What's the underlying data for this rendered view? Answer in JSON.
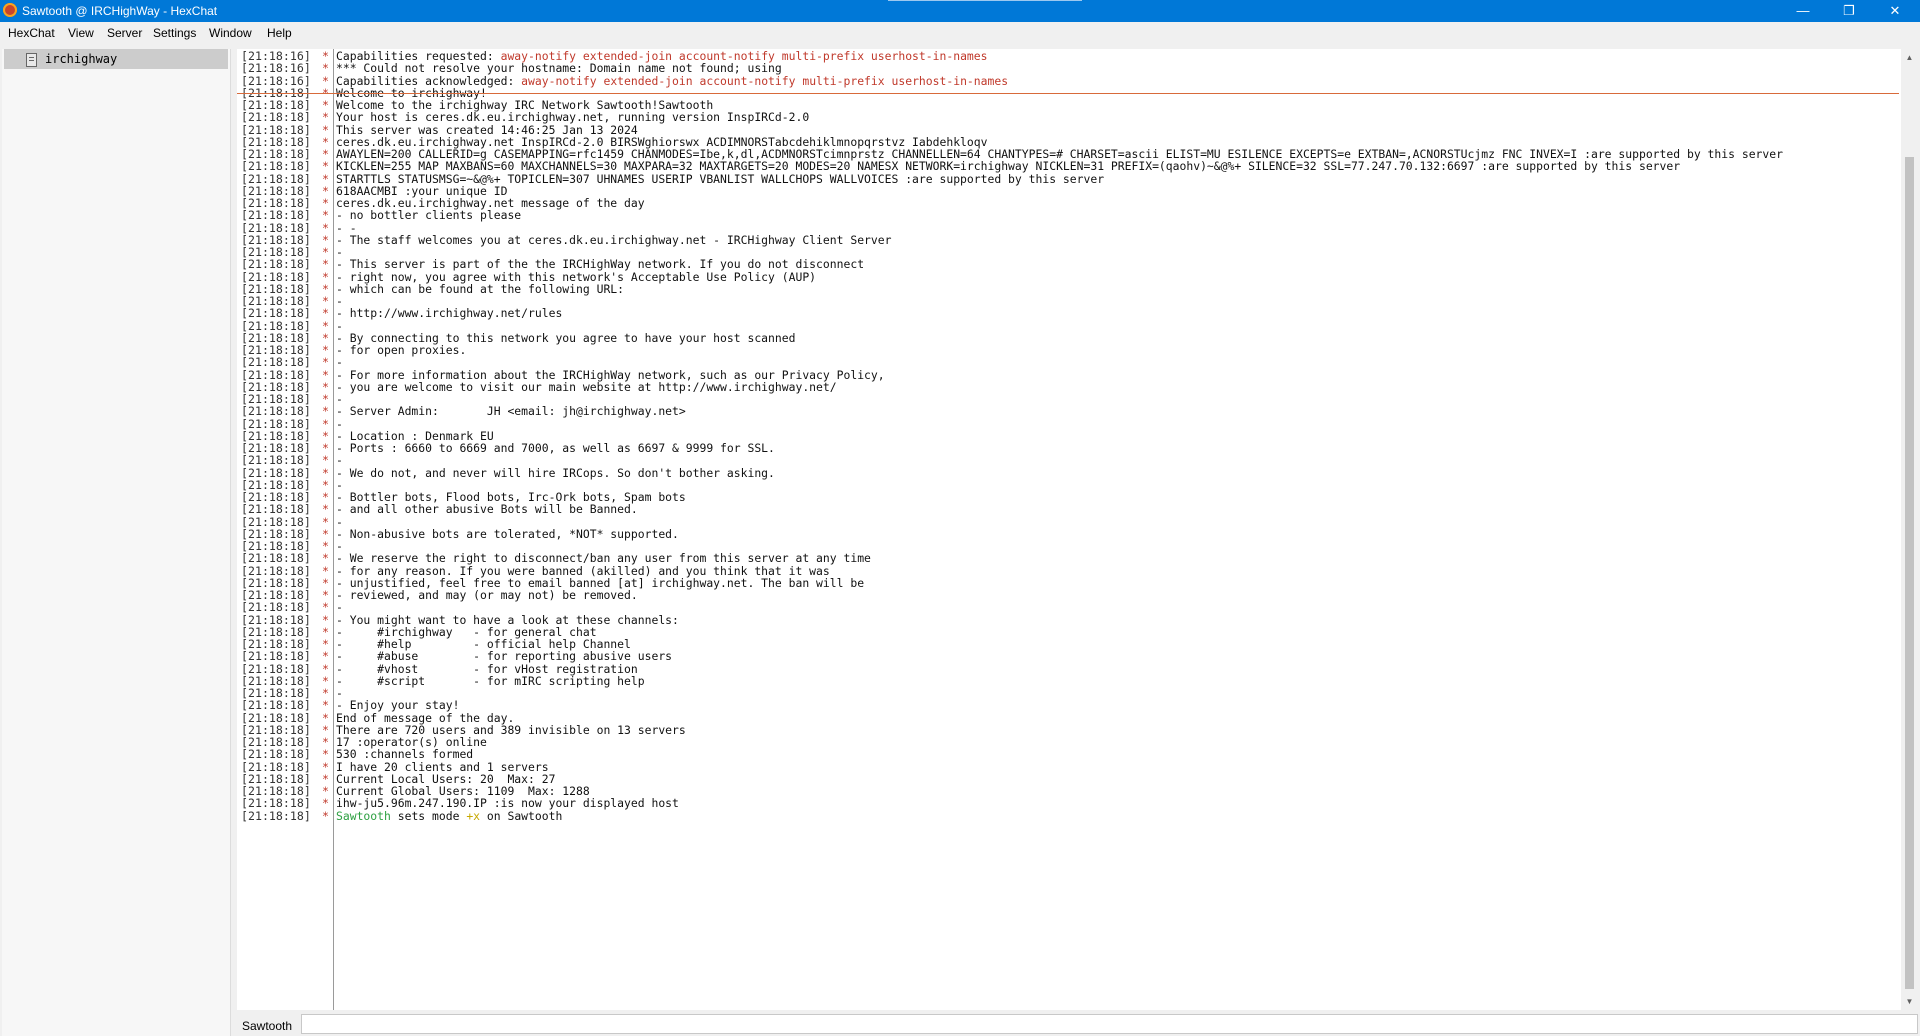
{
  "window": {
    "title": "Sawtooth @ IRCHighWay - HexChat"
  },
  "menu": [
    "HexChat",
    "View",
    "Server",
    "Settings",
    "Window",
    "Help"
  ],
  "sidebar": {
    "items": [
      {
        "label": "irchighway",
        "icon": "server-icon"
      }
    ]
  },
  "colors": {
    "titlebar": "#0078d7",
    "motd": "#b03a3a",
    "nick": "#2ea042",
    "mode": "#c7a800",
    "marker": "#d86a3a"
  },
  "chat": {
    "lines": [
      {
        "ts": "[21:18:16]",
        "p": "*",
        "segs": [
          {
            "t": "Capabilities requested: "
          },
          {
            "t": "away-notify extended-join account-notify multi-prefix userhost-in-names",
            "c": "hl-red"
          }
        ]
      },
      {
        "ts": "[21:18:16]",
        "p": "*",
        "segs": [
          {
            "t": "*** Could not resolve your hostname: Domain name not found; using"
          }
        ]
      },
      {
        "ts": "[21:18:16]",
        "p": "*",
        "segs": [
          {
            "t": "Capabilities acknowledged: "
          },
          {
            "t": "away-notify extended-join account-notify multi-prefix userhost-in-names",
            "c": "hl-red"
          }
        ]
      },
      {
        "ts": "[21:18:18]",
        "p": "*",
        "segs": [
          {
            "t": "Welcome to irchighway!"
          }
        ]
      },
      {
        "ts": "[21:18:18]",
        "p": "*",
        "segs": [
          {
            "t": "Welcome to the irchighway IRC Network Sawtooth!Sawtooth"
          }
        ]
      },
      {
        "ts": "[21:18:18]",
        "p": "*",
        "segs": [
          {
            "t": "Your host is ceres.dk.eu.irchighway.net, running version InspIRCd-2.0"
          }
        ]
      },
      {
        "ts": "[21:18:18]",
        "p": "*",
        "segs": [
          {
            "t": "This server was created 14:46:25 Jan 13 2024"
          }
        ]
      },
      {
        "ts": "[21:18:18]",
        "p": "*",
        "segs": [
          {
            "t": "ceres.dk.eu.irchighway.net InspIRCd-2.0 BIRSWghiorswx ACDIMNORSTabcdehiklmnopqrstvz Iabdehkloqv"
          }
        ]
      },
      {
        "ts": "[21:18:18]",
        "p": "*",
        "segs": [
          {
            "t": "AWAYLEN=200 CALLERID=g CASEMAPPING=rfc1459 CHANMODES=Ibe,k,dl,ACDMNORSTcimnprstz CHANNELLEN=64 CHANTYPES=# CHARSET=ascii ELIST=MU ESILENCE EXCEPTS=e EXTBAN=,ACNORSTUcjmz FNC INVEX=I :are supported by this server"
          }
        ]
      },
      {
        "ts": "[21:18:18]",
        "p": "*",
        "segs": [
          {
            "t": "KICKLEN=255 MAP MAXBANS=60 MAXCHANNELS=30 MAXPARA=32 MAXTARGETS=20 MODES=20 NAMESX NETWORK=irchighway NICKLEN=31 PREFIX=(qaohv)~&@%+ SILENCE=32 SSL=77.247.70.132:6697 :are supported by this server"
          }
        ]
      },
      {
        "ts": "[21:18:18]",
        "p": "*",
        "segs": [
          {
            "t": "STARTTLS STATUSMSG=~&@%+ TOPICLEN=307 UHNAMES USERIP VBANLIST WALLCHOPS WALLVOICES :are supported by this server"
          }
        ]
      },
      {
        "ts": "[21:18:18]",
        "p": "*",
        "segs": [
          {
            "t": "618AACMBI :your unique ID"
          }
        ]
      },
      {
        "ts": "[21:18:18]",
        "p": "*",
        "segs": [
          {
            "t": "ceres.dk.eu.irchighway.net message of the day",
            "c": "motd"
          }
        ]
      },
      {
        "ts": "[21:18:18]",
        "p": "*",
        "segs": [
          {
            "t": "- no bottler clients please",
            "c": "motd"
          }
        ]
      },
      {
        "ts": "[21:18:18]",
        "p": "*",
        "segs": [
          {
            "t": "- -",
            "c": "motd"
          }
        ]
      },
      {
        "ts": "[21:18:18]",
        "p": "*",
        "segs": [
          {
            "t": "- The staff welcomes you at ceres.dk.eu.irchighway.net - IRCHighway Client Server",
            "c": "motd"
          }
        ]
      },
      {
        "ts": "[21:18:18]",
        "p": "*",
        "segs": [
          {
            "t": "-",
            "c": "motd"
          }
        ]
      },
      {
        "ts": "[21:18:18]",
        "p": "*",
        "segs": [
          {
            "t": "- This server is part of the the IRCHighWay network. If you do not disconnect",
            "c": "motd"
          }
        ]
      },
      {
        "ts": "[21:18:18]",
        "p": "*",
        "segs": [
          {
            "t": "- right now, you agree with this network's Acceptable Use Policy (AUP)",
            "c": "motd"
          }
        ]
      },
      {
        "ts": "[21:18:18]",
        "p": "*",
        "segs": [
          {
            "t": "- which can be found at the following URL:",
            "c": "motd"
          }
        ]
      },
      {
        "ts": "[21:18:18]",
        "p": "*",
        "segs": [
          {
            "t": "-",
            "c": "motd"
          }
        ]
      },
      {
        "ts": "[21:18:18]",
        "p": "*",
        "segs": [
          {
            "t": "- http://www.irchighway.net/rules",
            "c": "motd"
          }
        ]
      },
      {
        "ts": "[21:18:18]",
        "p": "*",
        "segs": [
          {
            "t": "-",
            "c": "motd"
          }
        ]
      },
      {
        "ts": "[21:18:18]",
        "p": "*",
        "segs": [
          {
            "t": "- By connecting to this network you agree to have your host scanned",
            "c": "motd"
          }
        ]
      },
      {
        "ts": "[21:18:18]",
        "p": "*",
        "segs": [
          {
            "t": "- for open proxies.",
            "c": "motd"
          }
        ]
      },
      {
        "ts": "[21:18:18]",
        "p": "*",
        "segs": [
          {
            "t": "-",
            "c": "motd"
          }
        ]
      },
      {
        "ts": "[21:18:18]",
        "p": "*",
        "segs": [
          {
            "t": "- For more information about the IRCHighWay network, such as our Privacy Policy,",
            "c": "motd"
          }
        ]
      },
      {
        "ts": "[21:18:18]",
        "p": "*",
        "segs": [
          {
            "t": "- you are welcome to visit our main website at http://www.irchighway.net/",
            "c": "motd"
          }
        ]
      },
      {
        "ts": "[21:18:18]",
        "p": "*",
        "segs": [
          {
            "t": "-",
            "c": "motd"
          }
        ]
      },
      {
        "ts": "[21:18:18]",
        "p": "*",
        "segs": [
          {
            "t": "- Server Admin:       JH <email: jh@irchighway.net>",
            "c": "motd"
          }
        ]
      },
      {
        "ts": "[21:18:18]",
        "p": "*",
        "segs": [
          {
            "t": "-",
            "c": "motd"
          }
        ]
      },
      {
        "ts": "[21:18:18]",
        "p": "*",
        "segs": [
          {
            "t": "- Location : Denmark EU",
            "c": "motd"
          }
        ]
      },
      {
        "ts": "[21:18:18]",
        "p": "*",
        "segs": [
          {
            "t": "- Ports : 6660 to 6669 and 7000, as well as 6697 & 9999 for SSL.",
            "c": "motd"
          }
        ]
      },
      {
        "ts": "[21:18:18]",
        "p": "*",
        "segs": [
          {
            "t": "-",
            "c": "motd"
          }
        ]
      },
      {
        "ts": "[21:18:18]",
        "p": "*",
        "segs": [
          {
            "t": "- We do not, and never will hire IRCops. So don't bother asking.",
            "c": "motd"
          }
        ]
      },
      {
        "ts": "[21:18:18]",
        "p": "*",
        "segs": [
          {
            "t": "-",
            "c": "motd"
          }
        ]
      },
      {
        "ts": "[21:18:18]",
        "p": "*",
        "segs": [
          {
            "t": "- Bottler bots, Flood bots, Irc-Ork bots, Spam bots",
            "c": "motd"
          }
        ]
      },
      {
        "ts": "[21:18:18]",
        "p": "*",
        "segs": [
          {
            "t": "- and all other abusive Bots will be Banned.",
            "c": "motd"
          }
        ]
      },
      {
        "ts": "[21:18:18]",
        "p": "*",
        "segs": [
          {
            "t": "-",
            "c": "motd"
          }
        ]
      },
      {
        "ts": "[21:18:18]",
        "p": "*",
        "segs": [
          {
            "t": "- Non-abusive bots are tolerated, *NOT* supported.",
            "c": "motd"
          }
        ]
      },
      {
        "ts": "[21:18:18]",
        "p": "*",
        "segs": [
          {
            "t": "-",
            "c": "motd"
          }
        ]
      },
      {
        "ts": "[21:18:18]",
        "p": "*",
        "segs": [
          {
            "t": "- We reserve the right to disconnect/ban any user from this server at any time",
            "c": "motd"
          }
        ]
      },
      {
        "ts": "[21:18:18]",
        "p": "*",
        "segs": [
          {
            "t": "- for any reason. If you were banned (akilled) and you think that it was",
            "c": "motd"
          }
        ]
      },
      {
        "ts": "[21:18:18]",
        "p": "*",
        "segs": [
          {
            "t": "- unjustified, feel free to email banned [at] irchighway.net. The ban will be",
            "c": "motd"
          }
        ]
      },
      {
        "ts": "[21:18:18]",
        "p": "*",
        "segs": [
          {
            "t": "- reviewed, and may (or may not) be removed.",
            "c": "motd"
          }
        ]
      },
      {
        "ts": "[21:18:18]",
        "p": "*",
        "segs": [
          {
            "t": "-",
            "c": "motd"
          }
        ]
      },
      {
        "ts": "[21:18:18]",
        "p": "*",
        "segs": [
          {
            "t": "- You might want to have a look at these channels:",
            "c": "motd"
          }
        ]
      },
      {
        "ts": "[21:18:18]",
        "p": "*",
        "segs": [
          {
            "t": "-     #irchighway   - for general chat",
            "c": "motd"
          }
        ]
      },
      {
        "ts": "[21:18:18]",
        "p": "*",
        "segs": [
          {
            "t": "-     #help         - official help Channel",
            "c": "motd"
          }
        ]
      },
      {
        "ts": "[21:18:18]",
        "p": "*",
        "segs": [
          {
            "t": "-     #abuse        - for reporting abusive users",
            "c": "motd"
          }
        ]
      },
      {
        "ts": "[21:18:18]",
        "p": "*",
        "segs": [
          {
            "t": "-     #vhost        - for vHost registration",
            "c": "motd"
          }
        ]
      },
      {
        "ts": "[21:18:18]",
        "p": "*",
        "segs": [
          {
            "t": "-     #script       - for mIRC scripting help",
            "c": "motd"
          }
        ]
      },
      {
        "ts": "[21:18:18]",
        "p": "*",
        "segs": [
          {
            "t": "-",
            "c": "motd"
          }
        ]
      },
      {
        "ts": "[21:18:18]",
        "p": "*",
        "segs": [
          {
            "t": "- Enjoy your stay!",
            "c": "motd"
          }
        ]
      },
      {
        "ts": "[21:18:18]",
        "p": "*",
        "segs": [
          {
            "t": "End of message of the day.",
            "c": "motd"
          }
        ]
      },
      {
        "ts": "[21:18:18]",
        "p": "*",
        "segs": [
          {
            "t": "There are 720 users and 389 invisible on 13 servers"
          }
        ]
      },
      {
        "ts": "[21:18:18]",
        "p": "*",
        "segs": [
          {
            "t": "17 :operator(s) online"
          }
        ]
      },
      {
        "ts": "[21:18:18]",
        "p": "*",
        "segs": [
          {
            "t": "530 :channels formed"
          }
        ]
      },
      {
        "ts": "[21:18:18]",
        "p": "*",
        "segs": [
          {
            "t": "I have 20 clients and 1 servers"
          }
        ]
      },
      {
        "ts": "[21:18:18]",
        "p": "*",
        "segs": [
          {
            "t": "Current Local Users: 20  Max: 27"
          }
        ]
      },
      {
        "ts": "[21:18:18]",
        "p": "*",
        "segs": [
          {
            "t": "Current Global Users: 1109  Max: 1288"
          }
        ]
      },
      {
        "ts": "[21:18:18]",
        "p": "*",
        "segs": [
          {
            "t": "ihw-ju5.96m.247.190.IP :is now your displayed host"
          }
        ]
      },
      {
        "ts": "[21:18:18]",
        "p": "*",
        "segs": [
          {
            "t": "Sawtooth",
            "c": "hl-nick"
          },
          {
            "t": " sets mode "
          },
          {
            "t": "+x",
            "c": "hl-mode"
          },
          {
            "t": " on Sawtooth"
          }
        ]
      }
    ]
  },
  "input": {
    "nick": "Sawtooth",
    "value": ""
  }
}
